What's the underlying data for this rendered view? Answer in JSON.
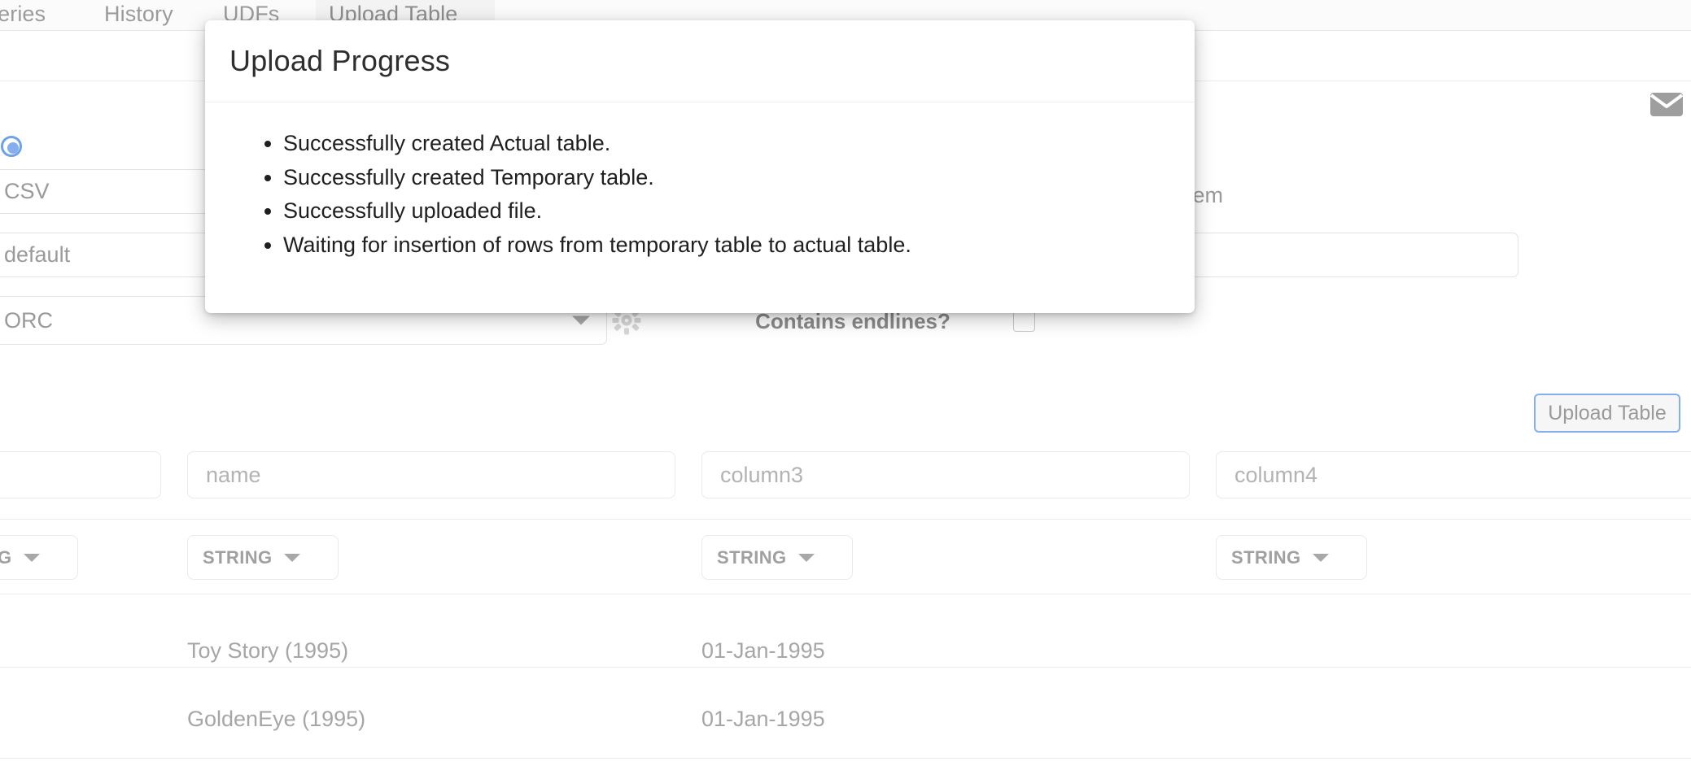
{
  "tabs": [
    {
      "label": "ueries",
      "active": false
    },
    {
      "label": "History",
      "active": false
    },
    {
      "label": "UDFs",
      "active": false
    },
    {
      "label": "Upload Table",
      "active": true
    }
  ],
  "icons": {
    "mail": "mail-icon",
    "gear": "gear-icon"
  },
  "form": {
    "file_type_value": "CSV",
    "database_value": "default",
    "storage_format_value": "ORC",
    "endlines_label": "Contains endlines?",
    "endlines_checked": false,
    "table_name_value": "item",
    "upload_button_label": "Upload Table",
    "radio_selected": true
  },
  "colors": {
    "accent_blue": "#85aeee",
    "radio_ring": "#6ea0ec",
    "muted_text": "#9a9a9a",
    "tab_text": "#9b9b9b",
    "modal_title": "#2e2e2e"
  },
  "table": {
    "columns": [
      {
        "name": "",
        "type": "STRING"
      },
      {
        "name": "name",
        "type": "STRING"
      },
      {
        "name": "column3",
        "type": "STRING"
      },
      {
        "name": "column4",
        "type": "STRING"
      }
    ],
    "rows": [
      {
        "c0": "",
        "c1": "Toy Story (1995)",
        "c2": "01-Jan-1995",
        "c3": ""
      },
      {
        "c0": "",
        "c1": "GoldenEye (1995)",
        "c2": "01-Jan-1995",
        "c3": ""
      }
    ]
  },
  "modal": {
    "title": "Upload Progress",
    "items": [
      "Successfully created Actual table.",
      "Successfully created Temporary table.",
      "Successfully uploaded file.",
      "Waiting for insertion of rows from temporary table to actual table."
    ]
  }
}
